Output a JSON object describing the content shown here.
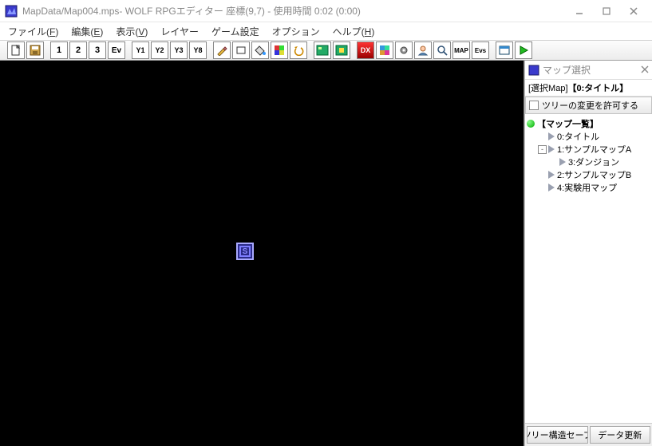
{
  "window": {
    "title": "MapData/Map004.mps- WOLF RPGエディター 座標(9,7)  - 使用時間 0:02 (0:00)"
  },
  "menu": {
    "file": "ファイル(",
    "file_k": "F",
    "edit": "編集(",
    "edit_k": "E",
    "view": "表示(",
    "view_k": "V",
    "layer": "レイヤー",
    "gamecfg": "ゲーム設定",
    "option": "オプション",
    "help": "ヘルプ(",
    "help_k": "H",
    "close_paren": ")"
  },
  "toolbar": {
    "l1": "1",
    "l2": "2",
    "l3": "3",
    "ev": "Ev",
    "y1": "Y1",
    "y2": "Y2",
    "y3": "Y3",
    "y8": "Y8",
    "map": "MAP",
    "dx": "DX",
    "evs": "Evs"
  },
  "sidepanel": {
    "title": "マップ選択",
    "selected_prefix": "[選択Map]",
    "selected_value": "【0:タイトル】",
    "allow_tree_change": "ツリーの変更を許可する",
    "root": "【マップ一覧】",
    "items": [
      {
        "label": "0:タイトル"
      },
      {
        "label": "1:サンプルマップA"
      },
      {
        "label": "3:ダンジョン"
      },
      {
        "label": "2:サンプルマップB"
      },
      {
        "label": "4:実験用マップ"
      }
    ],
    "btn_save": "ツリー構造セーブ",
    "btn_update": "データ更新"
  },
  "sprite": {
    "label": "S"
  }
}
